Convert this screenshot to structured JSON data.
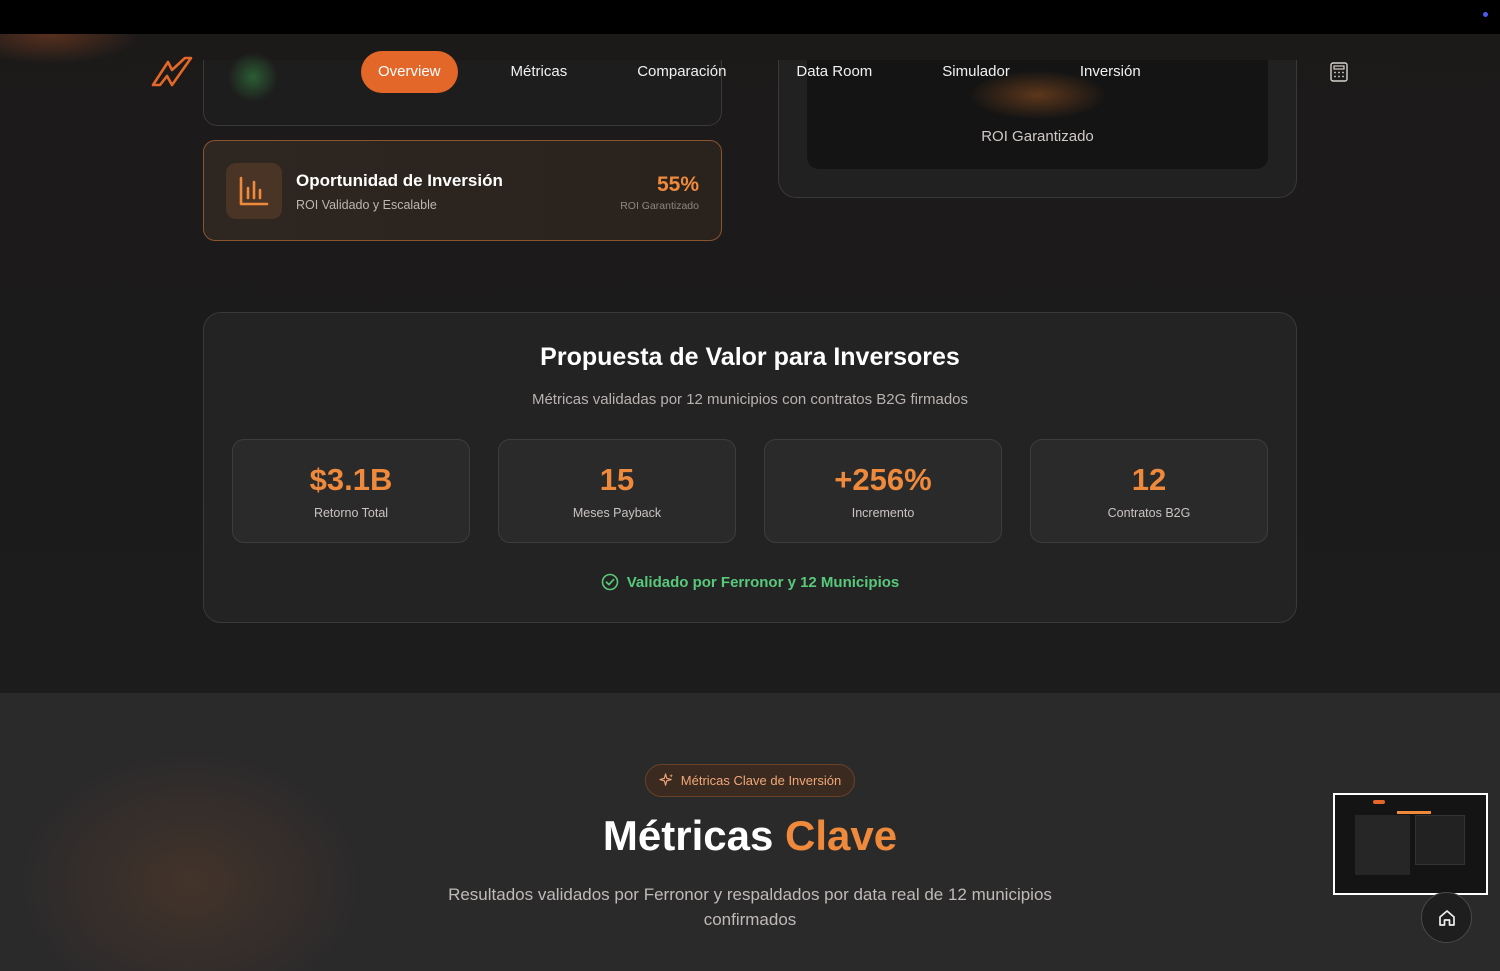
{
  "nav": {
    "items": [
      {
        "label": "Overview",
        "active": true
      },
      {
        "label": "Métricas",
        "active": false
      },
      {
        "label": "Comparación",
        "active": false
      },
      {
        "label": "Data Room",
        "active": false
      },
      {
        "label": "Simulador",
        "active": false
      },
      {
        "label": "Inversión",
        "active": false
      }
    ],
    "calculator_icon": "calculator-icon",
    "logo_icon": "brand-logo"
  },
  "opportunity": {
    "title": "Oportunidad de Inversión",
    "subtitle": "ROI Validado y Escalable",
    "percent": "55%",
    "percent_label": "ROI Garantizado",
    "icon": "bar-chart-icon"
  },
  "right_card": {
    "label": "ROI Garantizado"
  },
  "value_prop": {
    "title": "Propuesta de Valor para Inversores",
    "subtitle": "Métricas validadas por 12 municipios con contratos B2G firmados",
    "stats": [
      {
        "value": "$3.1B",
        "label": "Retorno Total"
      },
      {
        "value": "15",
        "label": "Meses Payback"
      },
      {
        "value": "+256%",
        "label": "Incremento"
      },
      {
        "value": "12",
        "label": "Contratos B2G"
      }
    ],
    "validation": "Validado por Ferronor y 12 Municipios"
  },
  "metrics": {
    "badge": "Métricas Clave de Inversión",
    "title_plain": "Métricas",
    "title_accent": "Clave",
    "subtitle": "Resultados validados por Ferronor y respaldados por data real de 12 municipios confirmados"
  },
  "colors": {
    "accent": "#e4672a",
    "accent_text": "#ef8a3c",
    "success": "#58c97a"
  }
}
